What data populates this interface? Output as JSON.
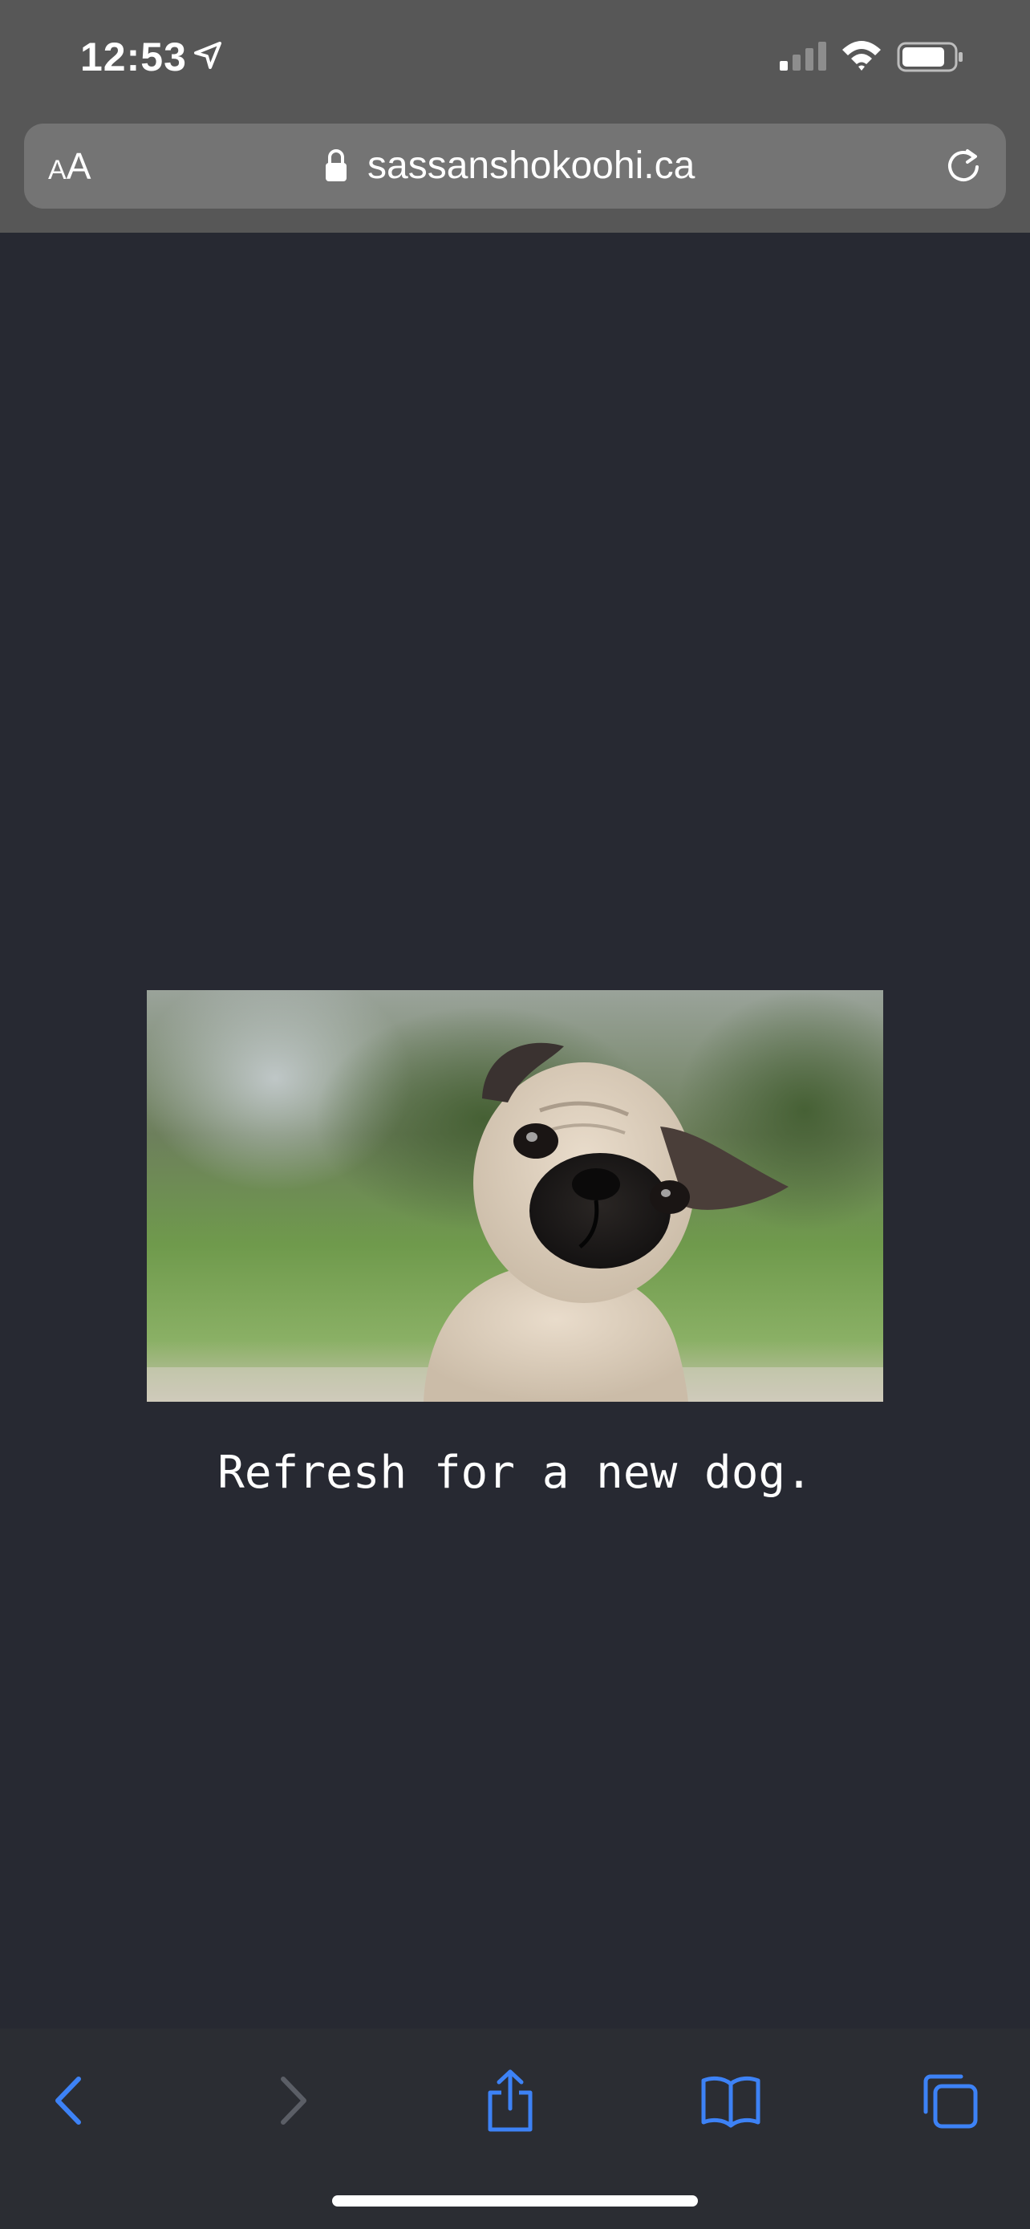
{
  "status_bar": {
    "time": "12:53",
    "location_icon": "location-arrow-icon",
    "signal_icon": "cellular-signal-icon",
    "wifi_icon": "wifi-icon",
    "battery_icon": "battery-icon"
  },
  "url_bar": {
    "reader_label_small": "A",
    "reader_label_big": "A",
    "lock_icon": "lock-icon",
    "url": "sassanshokoohi.ca",
    "reload_icon": "reload-icon"
  },
  "page": {
    "caption": "Refresh for a new dog."
  },
  "toolbar": {
    "back_icon": "chevron-left-icon",
    "forward_icon": "chevron-right-icon",
    "share_icon": "share-icon",
    "bookmarks_icon": "book-icon",
    "tabs_icon": "tabs-icon",
    "accent_color": "#3d82f6",
    "disabled_color": "#5b5e66"
  },
  "colors": {
    "page_background": "#272932",
    "chrome_background": "#575757",
    "url_field_background": "#747474"
  }
}
